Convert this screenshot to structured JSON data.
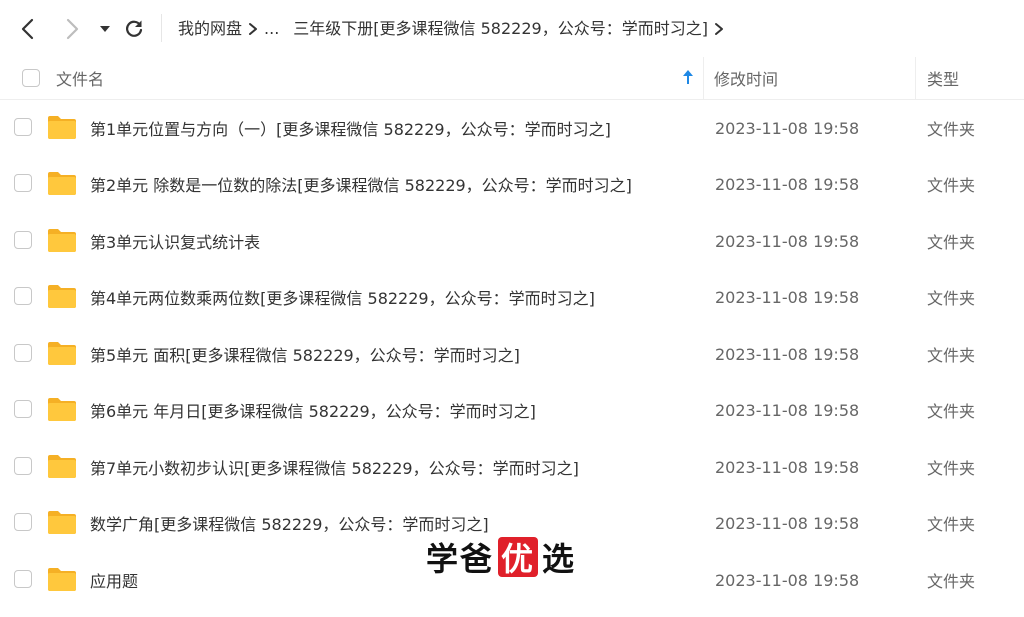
{
  "toolbar": {
    "back_icon": "chevron-left-icon",
    "forward_icon": "chevron-right-icon",
    "dropdown_icon": "caret-down-icon",
    "refresh_icon": "refresh-icon"
  },
  "breadcrumb": {
    "root": "我的网盘",
    "ellipsis": "...",
    "current": "三年级下册[更多课程微信 582229，公众号：学而时习之]"
  },
  "table": {
    "columns": {
      "name": "文件名",
      "modified": "修改时间",
      "type": "类型"
    },
    "sort": "ascending",
    "rows": [
      {
        "name": "第1单元位置与方向（一）[更多课程微信 582229，公众号：学而时习之]",
        "modified": "2023-11-08 19:58",
        "type": "文件夹"
      },
      {
        "name": "第2单元 除数是一位数的除法[更多课程微信 582229，公众号：学而时习之]",
        "modified": "2023-11-08 19:58",
        "type": "文件夹"
      },
      {
        "name": "第3单元认识复式统计表",
        "modified": "2023-11-08 19:58",
        "type": "文件夹"
      },
      {
        "name": "第4单元两位数乘两位数[更多课程微信 582229，公众号：学而时习之]",
        "modified": "2023-11-08 19:58",
        "type": "文件夹"
      },
      {
        "name": "第5单元 面积[更多课程微信 582229，公众号：学而时习之]",
        "modified": "2023-11-08 19:58",
        "type": "文件夹"
      },
      {
        "name": "第6单元 年月日[更多课程微信 582229，公众号：学而时习之]",
        "modified": "2023-11-08 19:58",
        "type": "文件夹"
      },
      {
        "name": "第7单元小数初步认识[更多课程微信 582229，公众号：学而时习之]",
        "modified": "2023-11-08 19:58",
        "type": "文件夹"
      },
      {
        "name": "数学广角[更多课程微信 582229，公众号：学而时习之]",
        "modified": "2023-11-08 19:58",
        "type": "文件夹"
      },
      {
        "name": "应用题",
        "modified": "2023-11-08 19:58",
        "type": "文件夹"
      }
    ]
  },
  "watermark": {
    "part1": "学爸",
    "highlight": "优",
    "part2": "选"
  },
  "colors": {
    "folder": "#FFC83D",
    "folder_dark": "#F5B025",
    "accent": "#1E88E5",
    "watermark_highlight": "#E0202A"
  }
}
